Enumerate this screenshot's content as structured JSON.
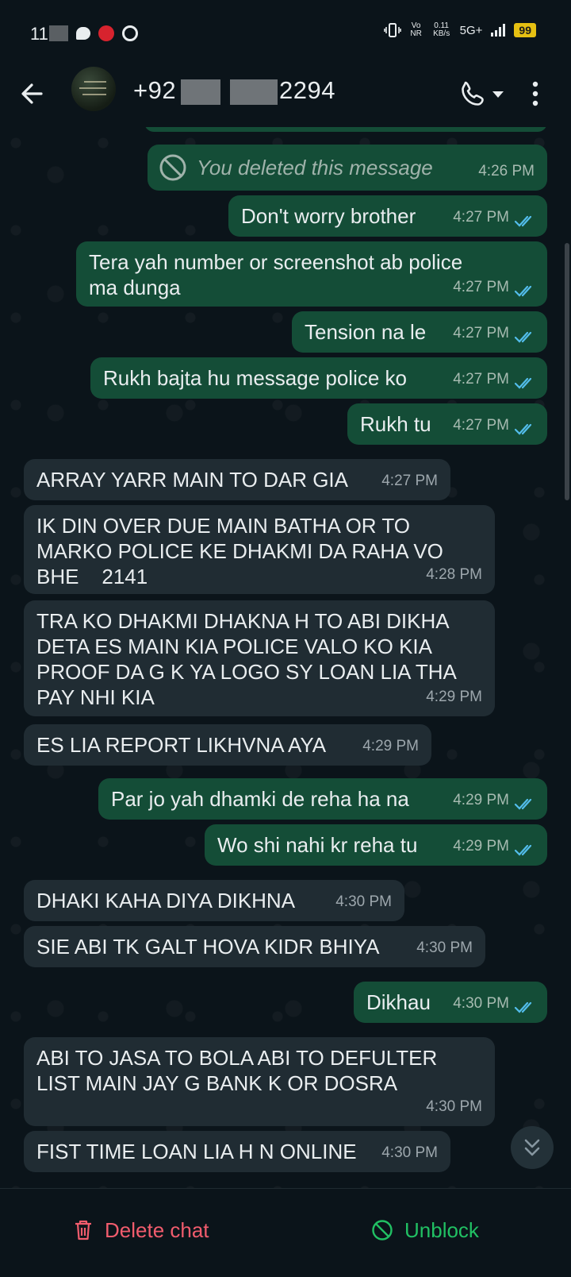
{
  "status_bar": {
    "time": "11",
    "network_speed": "0.11",
    "network_unit": "KB/s",
    "volte": "Vo NR",
    "network_type": "5G+",
    "battery": "99"
  },
  "header": {
    "phone_prefix": "+92",
    "phone_suffix": "2294"
  },
  "messages": [
    {
      "dir": "out",
      "text": "You deleted this message",
      "time": "4:26 PM",
      "deleted": true
    },
    {
      "dir": "out",
      "text": "Don't worry brother",
      "time": "4:27 PM"
    },
    {
      "dir": "out",
      "text": "Tera yah number or screenshot ab police\nma dunga",
      "time": "4:27 PM"
    },
    {
      "dir": "out",
      "text": "Tension na le",
      "time": "4:27 PM"
    },
    {
      "dir": "out",
      "text": "Rukh bajta hu message police ko",
      "time": "4:27 PM"
    },
    {
      "dir": "out",
      "text": "Rukh tu",
      "time": "4:27 PM"
    },
    {
      "dir": "in",
      "text": "ARRAY YARR MAIN TO DAR GIA",
      "time": "4:27 PM"
    },
    {
      "dir": "in",
      "text": "IK DIN OVER DUE MAIN BATHA OR TO\nMARKO POLICE KE DHAKMI DA RAHA VO\nBHE    2141",
      "time": "4:28 PM"
    },
    {
      "dir": "in",
      "text": "TRA KO DHAKMI DHAKNA H TO ABI DIKHA\nDETA ES MAIN KIA POLICE VALO KO KIA\nPROOF DA G K YA LOGO SY LOAN LIA THA\nPAY NHI KIA",
      "time": "4:29 PM"
    },
    {
      "dir": "in",
      "text": "ES LIA REPORT LIKHVNA AYA",
      "time": "4:29 PM"
    },
    {
      "dir": "out",
      "text": "Par jo yah dhamki de reha ha na",
      "time": "4:29 PM"
    },
    {
      "dir": "out",
      "text": "Wo shi nahi kr reha tu",
      "time": "4:29 PM"
    },
    {
      "dir": "in",
      "text": "DHAKI KAHA DIYA DIKHNA",
      "time": "4:30 PM"
    },
    {
      "dir": "in",
      "text": "SIE ABI TK GALT HOVA KIDR BHIYA",
      "time": "4:30 PM"
    },
    {
      "dir": "out",
      "text": "Dikhau",
      "time": "4:30 PM"
    },
    {
      "dir": "in",
      "text": "ABI TO JASA TO BOLA ABI TO DEFULTER\nLIST MAIN JAY G BANK K OR DOSRA",
      "time": "4:30 PM"
    },
    {
      "dir": "in",
      "text": "FIST TIME LOAN LIA H N ONLINE",
      "time": "4:30 PM"
    }
  ],
  "footer": {
    "delete_label": "Delete chat",
    "unblock_label": "Unblock"
  },
  "colors": {
    "outgoing_bubble": "#144d37",
    "incoming_bubble": "#202c33",
    "read_ticks": "#53bdeb",
    "delete": "#f15c6d",
    "unblock": "#21c063"
  }
}
